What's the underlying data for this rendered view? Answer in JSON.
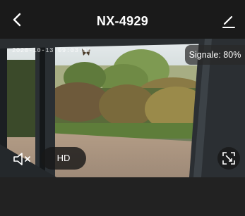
{
  "header": {
    "back_icon": "chevron-left-icon",
    "title": "NX-4929",
    "edit_icon": "pencil-icon"
  },
  "video": {
    "timestamp": "2020-10-13 09:03:52",
    "signal_label": "Signale: 80%",
    "signal_percent": 80,
    "mute_icon": "speaker-muted-icon",
    "quality_label": "HD",
    "fullscreen_icon": "expand-icon"
  },
  "colors": {
    "background": "#1e1e1e",
    "header_bg": "#1a1a1a",
    "overlay_bg": "#191919"
  }
}
